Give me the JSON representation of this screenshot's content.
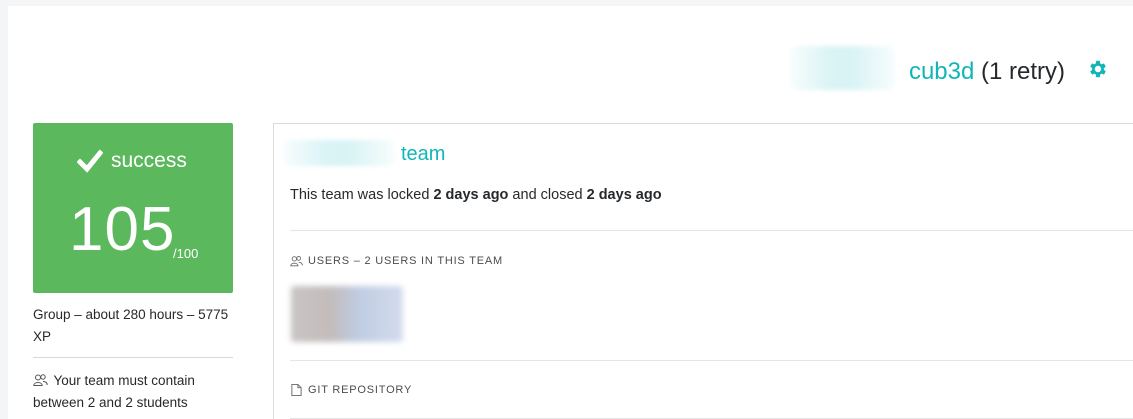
{
  "header": {
    "project_name": "cub3d",
    "retry_label": "(1 retry)",
    "settings_icon": "gear-icon",
    "accent_color": "#12b6b6"
  },
  "result": {
    "status": "success",
    "status_icon": "check-icon",
    "grade": "105",
    "grade_max": "/100",
    "color": "#5cb85c"
  },
  "project_meta": {
    "info": "Group – about 280 hours – 5775 XP",
    "team_requirement": "Your team must contain between 2 and 2 students"
  },
  "team": {
    "name_suffix": "team",
    "locked_prefix": "This team was locked ",
    "locked_time": "2 days ago",
    "closed_prefix": " and closed ",
    "closed_time": "2 days ago",
    "users_label": "USERS – 2 USERS IN THIS TEAM",
    "repo_label": "GIT REPOSITORY"
  }
}
